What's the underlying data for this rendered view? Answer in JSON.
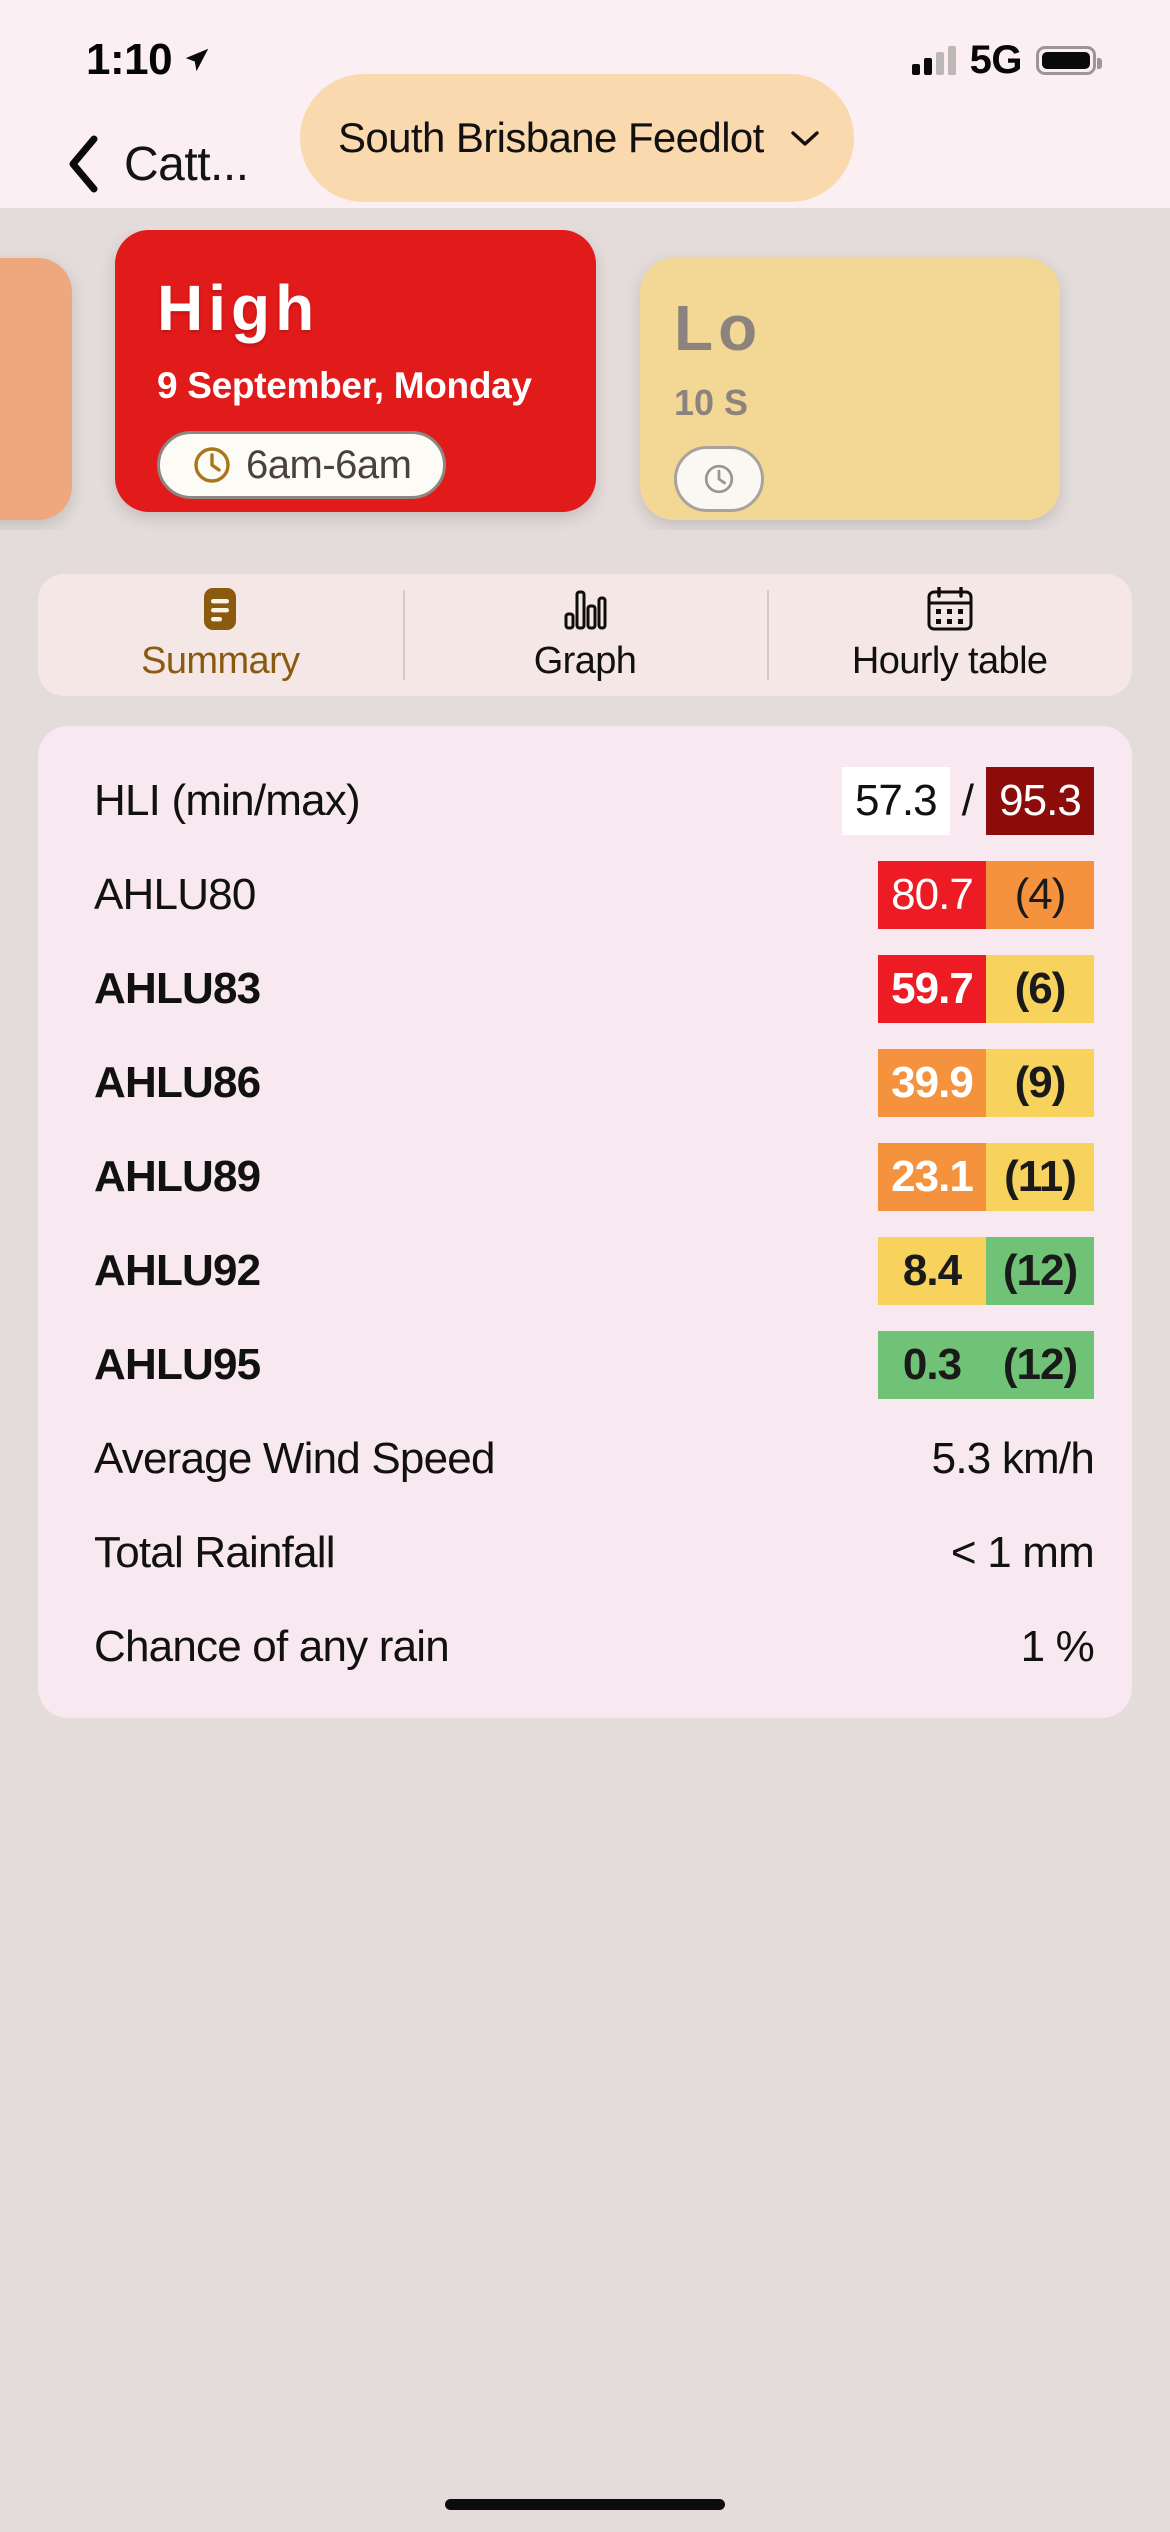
{
  "status_bar": {
    "time": "1:10",
    "network": "5G",
    "location_icon": "location-arrow-icon",
    "signal_icon": "cellular-signal-icon",
    "battery_icon": "battery-full-icon"
  },
  "nav": {
    "back_icon": "chevron-left-icon",
    "title": "Catt...",
    "farm_selector": {
      "label": "South Brisbane Feedlot",
      "chevron_icon": "chevron-down-icon"
    }
  },
  "carousel": {
    "prev_card": {
      "color": "#EFA87E"
    },
    "main_card": {
      "level": "High",
      "date": "9 September, Monday",
      "time_range": "6am-6am",
      "clock_icon": "clock-icon",
      "color": "#E11A1A"
    },
    "next_card": {
      "level": "Lo",
      "date": "10 S",
      "clock_icon": "clock-icon",
      "color": "#F3D795"
    }
  },
  "tabs": [
    {
      "label": "Summary",
      "icon": "summary-document-icon",
      "active": true
    },
    {
      "label": "Graph",
      "icon": "bar-chart-icon",
      "active": false
    },
    {
      "label": "Hourly table",
      "icon": "calendar-icon",
      "active": false
    }
  ],
  "summary": {
    "rows": [
      {
        "label": "HLI (min/max)",
        "bold": false,
        "type": "pair_slash",
        "values": [
          {
            "text": "57.3",
            "bg": "#FFFFFF",
            "fg": "#111111"
          },
          {
            "text": "95.3",
            "bg": "#8C0C0C",
            "fg": "#FFFFFF"
          }
        ]
      },
      {
        "label": "AHLU80",
        "bold": false,
        "type": "pair",
        "values": [
          {
            "text": "80.7",
            "bg": "#ED1C24",
            "fg": "#FFFFFF"
          },
          {
            "text": "(4)",
            "bg": "#F5923E",
            "fg": "#1A1A1A"
          }
        ]
      },
      {
        "label": "AHLU83",
        "bold": true,
        "type": "pair",
        "values": [
          {
            "text": "59.7",
            "bg": "#ED1C24",
            "fg": "#FFFFFF"
          },
          {
            "text": "(6)",
            "bg": "#F7D35E",
            "fg": "#1A1A1A"
          }
        ]
      },
      {
        "label": "AHLU86",
        "bold": true,
        "type": "pair",
        "values": [
          {
            "text": "39.9",
            "bg": "#F5923E",
            "fg": "#FFFFFF"
          },
          {
            "text": "(9)",
            "bg": "#F7D35E",
            "fg": "#1A1A1A"
          }
        ]
      },
      {
        "label": "AHLU89",
        "bold": true,
        "type": "pair",
        "values": [
          {
            "text": "23.1",
            "bg": "#F5923E",
            "fg": "#FFFFFF"
          },
          {
            "text": "(11)",
            "bg": "#F7D35E",
            "fg": "#1A1A1A"
          }
        ]
      },
      {
        "label": "AHLU92",
        "bold": true,
        "type": "pair",
        "values": [
          {
            "text": "8.4",
            "bg": "#F7D35E",
            "fg": "#1A1A1A"
          },
          {
            "text": "(12)",
            "bg": "#6FC276",
            "fg": "#1A1A1A"
          }
        ]
      },
      {
        "label": "AHLU95",
        "bold": true,
        "type": "pair",
        "values": [
          {
            "text": "0.3",
            "bg": "#6FC276",
            "fg": "#1A1A1A"
          },
          {
            "text": "(12)",
            "bg": "#6FC276",
            "fg": "#1A1A1A"
          }
        ]
      },
      {
        "label": "Average Wind Speed",
        "bold": false,
        "type": "plain",
        "text": "5.3 km/h"
      },
      {
        "label": "Total Rainfall",
        "bold": false,
        "type": "plain",
        "text": "< 1 mm"
      },
      {
        "label": "Chance of any rain",
        "bold": false,
        "type": "plain",
        "text": "1 %"
      }
    ]
  }
}
